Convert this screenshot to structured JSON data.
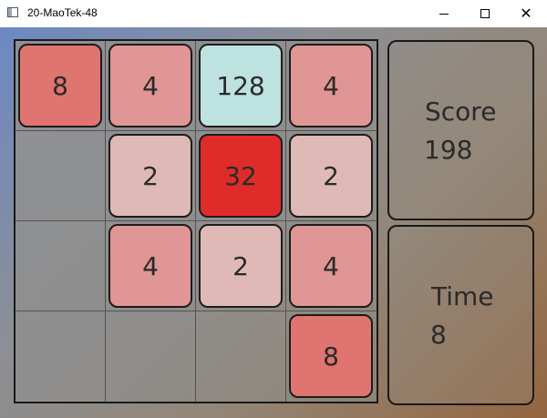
{
  "window": {
    "title": "20-MaoTek-48",
    "minimize_label": "—",
    "maximize_label": "☐",
    "close_label": "✕"
  },
  "colors": {
    "tile_2": "#dfb9b5",
    "tile_4": "#df9694",
    "tile_8": "#df7470",
    "tile_32": "#e02b2b",
    "tile_128": "#bde2df"
  },
  "board": {
    "rows": [
      [
        "8",
        "4",
        "128",
        "4"
      ],
      [
        "",
        "2",
        "32",
        "2"
      ],
      [
        "",
        "4",
        "2",
        "4"
      ],
      [
        "",
        "",
        "",
        "8"
      ]
    ]
  },
  "score": {
    "label": "Score",
    "value": "198"
  },
  "time": {
    "label": "Time",
    "value": "8"
  }
}
